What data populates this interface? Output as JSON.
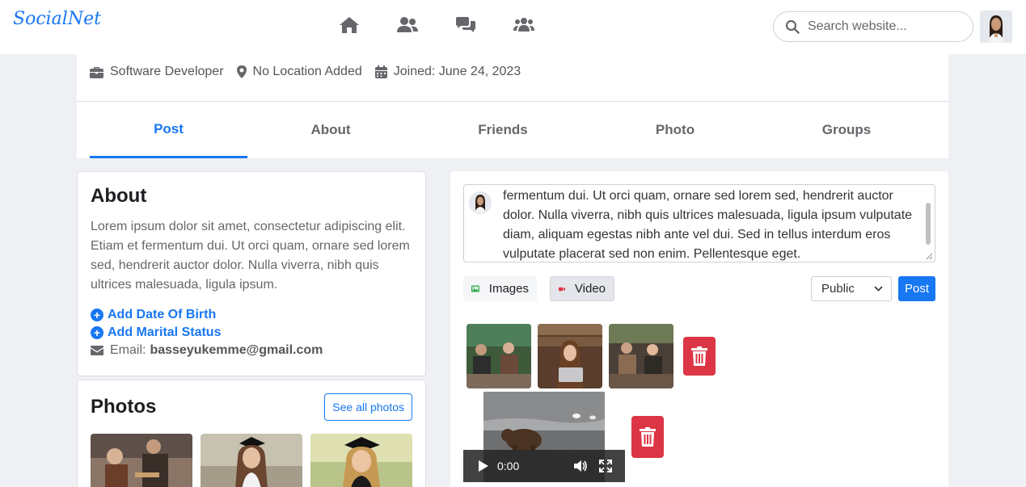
{
  "brand": {
    "logo": "SocialNet",
    "accent": "#1877f2"
  },
  "nav": {
    "icons": [
      "home-icon",
      "friends-icon",
      "messages-icon",
      "groups-icon"
    ],
    "search_placeholder": "Search website..."
  },
  "profile": {
    "job": "Software Developer",
    "location": "No Location Added",
    "joined": "Joined: June 24, 2023"
  },
  "tabs": [
    {
      "label": "Post",
      "active": true
    },
    {
      "label": "About",
      "active": false
    },
    {
      "label": "Friends",
      "active": false
    },
    {
      "label": "Photo",
      "active": false
    },
    {
      "label": "Groups",
      "active": false
    }
  ],
  "about": {
    "title": "About",
    "text": "Lorem ipsum dolor sit amet, consectetur adipiscing elit. Etiam et fermentum dui. Ut orci quam, ornare sed lorem sed, hendrerit auctor dolor. Nulla viverra, nibh quis ultrices malesuada, ligula ipsum.",
    "add_dob": "Add Date Of Birth",
    "add_marital": "Add Marital Status",
    "email_label": "Email:",
    "email_value": "basseyukemme@gmail.com"
  },
  "photos": {
    "title": "Photos",
    "see_all": "See all photos"
  },
  "composer": {
    "text": "fermentum dui. Ut orci quam, ornare sed lorem sed, hendrerit auctor dolor. Nulla viverra, nibh quis ultrices malesuada, ligula ipsum vulputate diam, aliquam egestas nibh ante vel dui. Sed in tellus interdum eros vulputate placerat sed non enim. Pellentesque eget.",
    "images_label": "Images",
    "video_label": "Video",
    "privacy_value": "Public",
    "post_label": "Post",
    "video_time": "0:00",
    "danger_color": "#dc3545"
  }
}
